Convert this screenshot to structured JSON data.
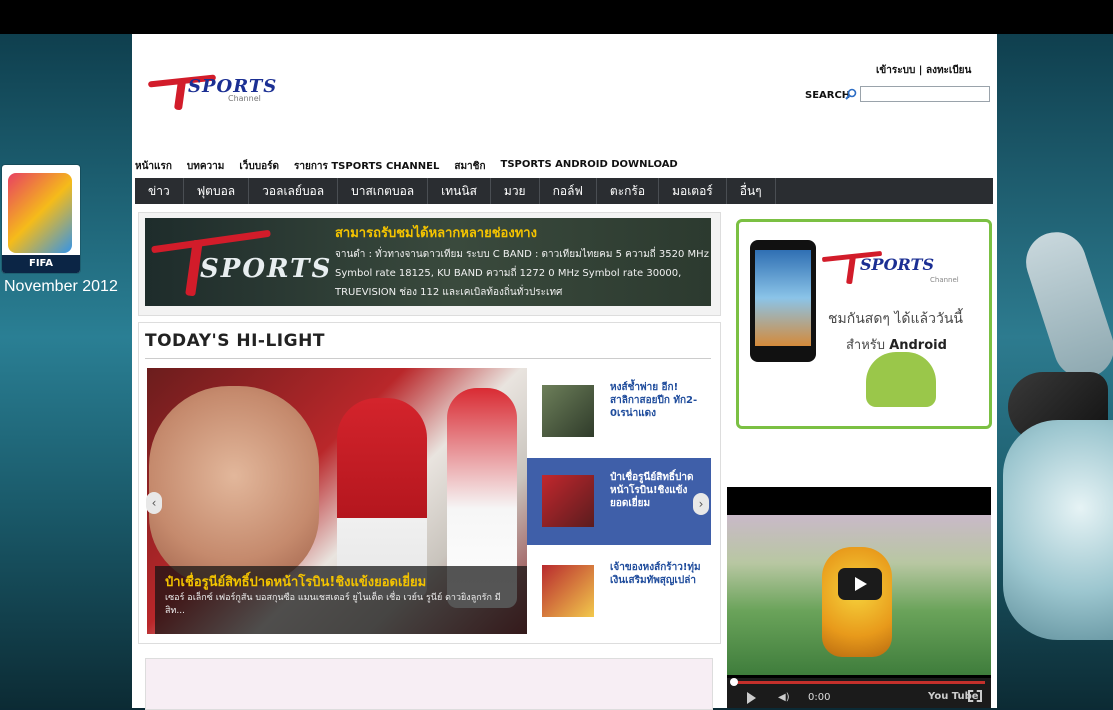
{
  "logo": {
    "word": "SPORTS",
    "sub": "Channel"
  },
  "header": {
    "login": "เข้าระบบ",
    "separator": "|",
    "register": "ลงทะเบียน",
    "search_label": "SEARCH",
    "search_value": ""
  },
  "top_nav": [
    "หน้าแรก",
    "บทความ",
    "เว็บบอร์ด",
    "รายการ TSPORTS CHANNEL",
    "สมาชิก",
    "TSPORTS ANDROID DOWNLOAD"
  ],
  "main_nav": [
    "ข่าว",
    "ฟุตบอล",
    "วอลเลย์บอล",
    "บาสเกตบอล",
    "เทนนิส",
    "มวย",
    "กอล์ฟ",
    "ตะกร้อ",
    "มอเตอร์",
    "อื่นๆ"
  ],
  "banner": {
    "brand": "SPORTS",
    "headline": "สามารถรับชมได้หลากหลายช่องทาง",
    "line1": "จานดำ : ทั่วทางจานดาวเทียม ระบบ C BAND : ดาวเทียมไทยคม 5 ความถี่ 3520 MHz",
    "line2": "Symbol rate 18125, KU BAND ความถี่ 1272 0 MHz Symbol rate 30000,",
    "line3": "TRUEVISION ช่อง 112 และเคเบิลท้องถิ่นทั่วประเทศ"
  },
  "highlight": {
    "title": "TODAY'S HI-LIGHT",
    "featured_title": "ป๋าเชื่อรูนีย์สิทธิ์ปาดหน้าโรบิน!ชิงแข้งยอดเยี่ยม",
    "featured_text": "เซอร์ อเล็กซ์ เฟอร์กูสัน บอสกุนซือ แมนเชสเตอร์ ยูไนเต็ด เชื่อ เวย์น รูนีย์ ดาวยิงลูกรัก มีสิท...",
    "arrow_left": "‹",
    "arrow_right": "›",
    "items": [
      {
        "text": "หงส์ช้ำพ่าย อีก!สาลิกาสอยปีก ทัก2-0เรน่าแดง"
      },
      {
        "text": "ป๋าเชื่อรูนีย์สิทธิ์ปาด หน้าโรบิน!ชิงแข้ง ยอดเยี่ยม"
      },
      {
        "text": "เจ้าของหงส์กร้าว!ทุ่ม เงินเสริมทัพสุญเปล่า"
      }
    ]
  },
  "ad": {
    "brand": "SPORTS",
    "sub": "Channel",
    "line1": "ชมกันสดๆ ได้แล้ววันนี้",
    "line2_prefix": "สำหรับ",
    "line2_bold": "Android"
  },
  "video": {
    "time": "0:00",
    "logo_text": "You Tube",
    "volume_icon": "◀)"
  },
  "left_poster": {
    "caption": "November 2012",
    "badge": "FIFA"
  }
}
